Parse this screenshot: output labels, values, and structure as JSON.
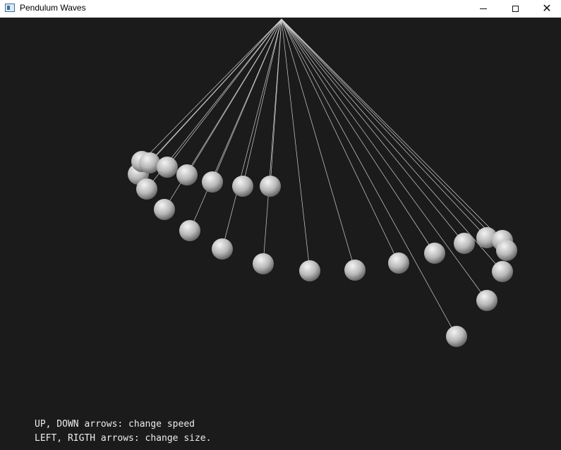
{
  "window": {
    "title": "Pendulum Waves",
    "icon": "app-window-icon",
    "buttons": [
      "minimize-icon",
      "maximize-icon",
      "close-icon"
    ]
  },
  "instructions": {
    "line1": "UP, DOWN arrows: change speed",
    "line2": "LEFT, RIGTH arrows: change size."
  },
  "colors": {
    "background": "#1b1b1b",
    "string": "#d0d0d0",
    "ball_light": "#f2f2f2",
    "ball_dark": "#5a5a5a",
    "text": "#ececec"
  },
  "pendulum": {
    "count": 24
  }
}
